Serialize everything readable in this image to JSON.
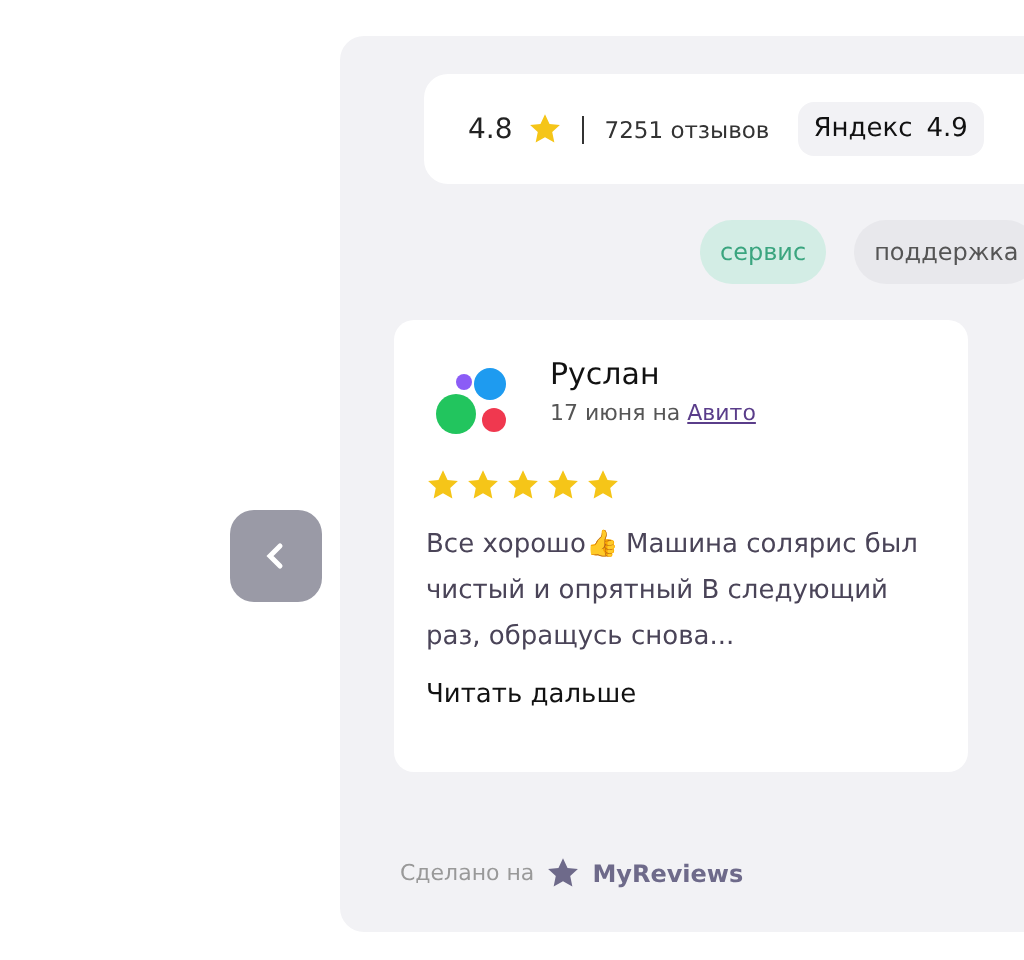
{
  "summary": {
    "rating": "4.8",
    "reviews_count": "7251 отзывов",
    "sources": [
      {
        "name": "Яндекс",
        "rating": "4.9"
      }
    ]
  },
  "tags": [
    {
      "label": "сервис",
      "selected": true
    },
    {
      "label": "поддержка",
      "selected": false
    }
  ],
  "review": {
    "author": "Руслан",
    "date": "17 июня на",
    "source": "Авито",
    "stars": 5,
    "text": "Все хорошо👍  Машина солярис был чистый и опрятный В следующий раз, обращусь снова...",
    "read_more": "Читать дальше"
  },
  "footer": {
    "label": "Сделано на",
    "brand": "MyReviews"
  }
}
